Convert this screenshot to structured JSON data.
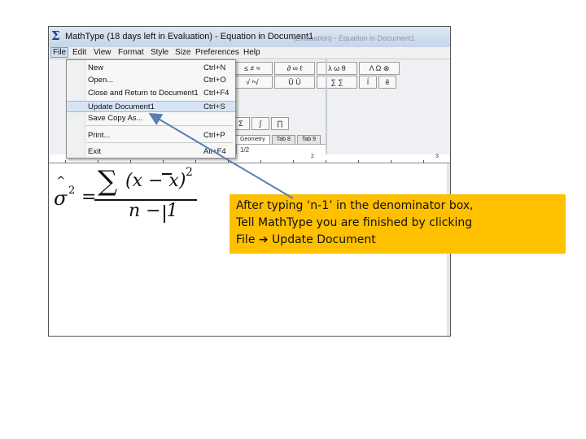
{
  "window": {
    "title": "MathType (18 days left in Evaluation) - Equation in Document1",
    "title_ghost": "(Evaluation) - Equation in Document1"
  },
  "menubar": [
    "File",
    "Edit",
    "View",
    "Format",
    "Style",
    "Size",
    "Preferences",
    "Help"
  ],
  "file_menu": [
    {
      "label": "New",
      "shortcut": "Ctrl+N"
    },
    {
      "label": "Open...",
      "shortcut": "Ctrl+O"
    },
    {
      "label": "Close and Return to Document1",
      "shortcut": "Ctrl+F4"
    },
    {
      "label": "Update Document1",
      "shortcut": "Ctrl+S"
    },
    {
      "label": "Save Copy As...",
      "shortcut": ""
    },
    {
      "label": "Print...",
      "shortcut": "Ctrl+P"
    },
    {
      "label": "Exit",
      "shortcut": "Alt+F4"
    }
  ],
  "toolbar": {
    "row1": [
      "≤ ≠ ≈",
      "∂ ∞ ℓ",
      "λ ω θ",
      "Λ Ω ⊗"
    ],
    "row2": [
      "√ ⁿ√",
      "Ū Ú",
      "∑ ∑",
      "ĺ",
      "ē"
    ],
    "row3": [
      "Σ",
      "∫",
      "∏"
    ],
    "tabs": [
      "Geometry",
      "Tab 8",
      "Tab 9"
    ],
    "palette_fraction": "1/2"
  },
  "ruler": {
    "numbers": [
      "2",
      "3"
    ]
  },
  "equation": {
    "lhs_symbol": "σ",
    "lhs_hat": "^",
    "lhs_exponent": "2",
    "equals": "=",
    "sum_symbol": "∑",
    "numerator": "(x − x)",
    "numerator_exponent": "2",
    "denominator": "n − 1"
  },
  "callout": {
    "line1": "After typing  ‘n-1’ in the denominator box,",
    "line2": "Tell MathType you are finished by clicking",
    "line3": "File ➔ Update Document"
  },
  "colors": {
    "callout_bg": "#ffc000",
    "arrow": "#5b7db5",
    "menu_highlight": "#d6e5f5"
  }
}
